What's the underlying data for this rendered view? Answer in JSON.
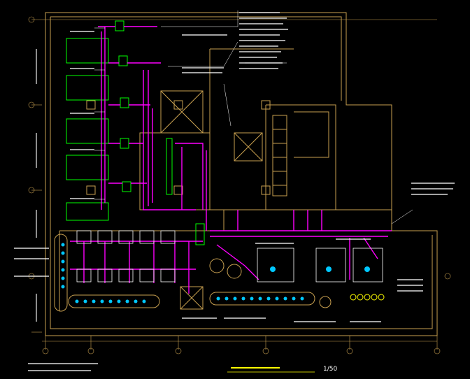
{
  "drawing": {
    "scale": "1/50",
    "colors": {
      "background": "#000000",
      "wall": "#c8a050",
      "wire": "#ff00ff",
      "panel": "#00ff00",
      "equipment": "#00c8ff",
      "text": "#ffffff",
      "grid": "#c8a050",
      "title": "#ffff00"
    }
  }
}
